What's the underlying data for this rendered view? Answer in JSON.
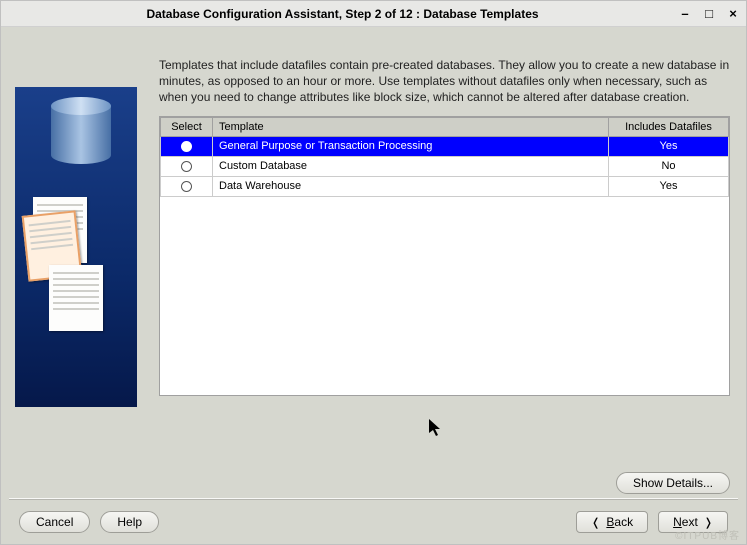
{
  "titlebar": {
    "title": "Database Configuration Assistant, Step 2 of 12 : Database Templates"
  },
  "description": "Templates that include datafiles contain pre-created databases. They allow you to create a new database in minutes, as opposed to an hour or more. Use templates without datafiles only when necessary, such as when you need to change attributes like block size, which cannot be altered after database creation.",
  "table": {
    "columns": {
      "select": "Select",
      "template": "Template",
      "includes": "Includes Datafiles"
    },
    "rows": [
      {
        "selected": true,
        "template": "General Purpose or Transaction Processing",
        "includes": "Yes"
      },
      {
        "selected": false,
        "template": "Custom Database",
        "includes": "No"
      },
      {
        "selected": false,
        "template": "Data Warehouse",
        "includes": "Yes"
      }
    ]
  },
  "buttons": {
    "show_details": "Show Details...",
    "cancel": "Cancel",
    "help": "Help",
    "back_prefix": "B",
    "back_rest": "ack",
    "next_prefix": "N",
    "next_rest": "ext"
  },
  "watermark": "©ITPUB博客"
}
